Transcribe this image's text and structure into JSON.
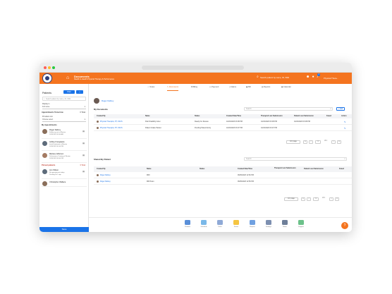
{
  "app": {
    "title": "Documents",
    "subtitle": "RaeRi In-Health Physical Therapy & Performance",
    "search_placeholder": "Search patient by name, ID, SSN",
    "notif_count": "3",
    "user": "Physical Thera...",
    "brand_color": "#f4741f",
    "accent_color": "#1a73e8"
  },
  "sidebar": {
    "title": "Patients",
    "filter_label": "Filter",
    "add_label": "+",
    "search_placeholder": "Search patient by name, ID, SSN",
    "display_in_label": "Display in",
    "display_in_value": "Full name",
    "provider_label": "Providers List",
    "provider_value": "Choose select",
    "appointments_tomorrow": {
      "label": "Appointments Tomorrow",
      "count": "0 Total"
    },
    "my_appointments": {
      "label": "My Appointments"
    },
    "appointments": [
      {
        "name": "Roger Daltrey",
        "line2": "Follow-up visit at Weston",
        "line3": "10/24/2023 09:00 AM"
      },
      {
        "name": "Ashley Frangipane",
        "line2": "Initial Evaluation at Weston",
        "line3": "10/24/2023 01:00 PM"
      },
      {
        "name": "Melissa Jefferson",
        "line2": "Performance Training at Weston",
        "line3": "10/24/2023 03:00 PM"
      }
    ],
    "pinned": {
      "label": "Pinned patients",
      "count": "3 Total"
    },
    "pinned_patients": [
      {
        "name": "Ann Wilson",
        "line2": "No appointments today",
        "line3": "Pending PoC sign"
      },
      {
        "name": "Christopher Wallace",
        "line2": "",
        "line3": ""
      }
    ],
    "save_label": "Save"
  },
  "tabs": [
    {
      "label": "Notes",
      "icon": "person-icon"
    },
    {
      "label": "Documents",
      "icon": "pencil-icon",
      "active": true
    },
    {
      "label": "Billing",
      "icon": "dollar-icon"
    },
    {
      "label": "Payment",
      "icon": "card-icon"
    },
    {
      "label": "Claims",
      "icon": "file-icon"
    },
    {
      "label": "Bill",
      "icon": "cash-icon"
    },
    {
      "label": "Reports",
      "icon": "chart-icon"
    },
    {
      "label": "Calendar",
      "icon": "calendar-icon"
    }
  ],
  "patient": {
    "name": "Roger Daltrey"
  },
  "my_documents": {
    "title": "My Documents",
    "search_placeholder": "Search",
    "add_label": "+ Add",
    "columns": [
      "Created By",
      "Name",
      "Status",
      "Created Date/Time",
      "Therapist Last Submission",
      "Patient Last Submission",
      "Faxed",
      "Action"
    ],
    "rows": [
      {
        "created_by": "Physical Therapist, PT, CSCS",
        "name": "Pain Disability Index",
        "status": "Ready For Review",
        "created": "10/22/2023 03:08 PM",
        "therapist": "10/22/2023 03:08 PM",
        "patient": "10/22/2023 03:08 PM",
        "faxed": ""
      },
      {
        "created_by": "Physical Therapist, PT, CSCS",
        "name": "Patient Intake Packet",
        "status": "Pending Patient Entry",
        "created": "10/22/2023 03:07 PM",
        "therapist": "10/22/2023 03:07 PM",
        "patient": "",
        "faxed": ""
      }
    ],
    "pager": {
      "page_size": "10 / page",
      "page": "1",
      "total": "of 1"
    }
  },
  "shared_documents": {
    "title": "Shared By Patient",
    "search_placeholder": "Search",
    "columns": [
      "Created By",
      "Name",
      "Status",
      "Created Date/Time",
      "Therapist Last Submission",
      "Patient Last Submission",
      "Faxed"
    ],
    "rows": [
      {
        "created_by": "Roger Daltrey",
        "name": "MRI",
        "status": "",
        "created": "09/30/2023 12:52 PM",
        "therapist": "",
        "patient": "",
        "faxed": ""
      },
      {
        "created_by": "Roger Daltrey",
        "name": "MRI Scan",
        "status": "",
        "created": "09/30/2023 12:50 PM",
        "therapist": "",
        "patient": "",
        "faxed": ""
      }
    ],
    "pager": {
      "page_size": "10 / page",
      "page": "1",
      "total": "of 1"
    }
  },
  "bottom_nav": [
    {
      "label": "Patients",
      "color": "#5a8fd8"
    },
    {
      "label": "Schedule",
      "color": "#7ab8e8"
    },
    {
      "label": "Tasks",
      "color": "#8fa9d6"
    },
    {
      "label": "Forms",
      "color": "#f5c542"
    },
    {
      "label": "Reports",
      "color": "#6fa0e0"
    },
    {
      "label": "Settings",
      "color": "#7d8fb0"
    },
    {
      "label": "Notes",
      "color": "#6e7f99"
    },
    {
      "label": "Support",
      "color": "#6cc18a"
    }
  ],
  "fab_label": "?"
}
